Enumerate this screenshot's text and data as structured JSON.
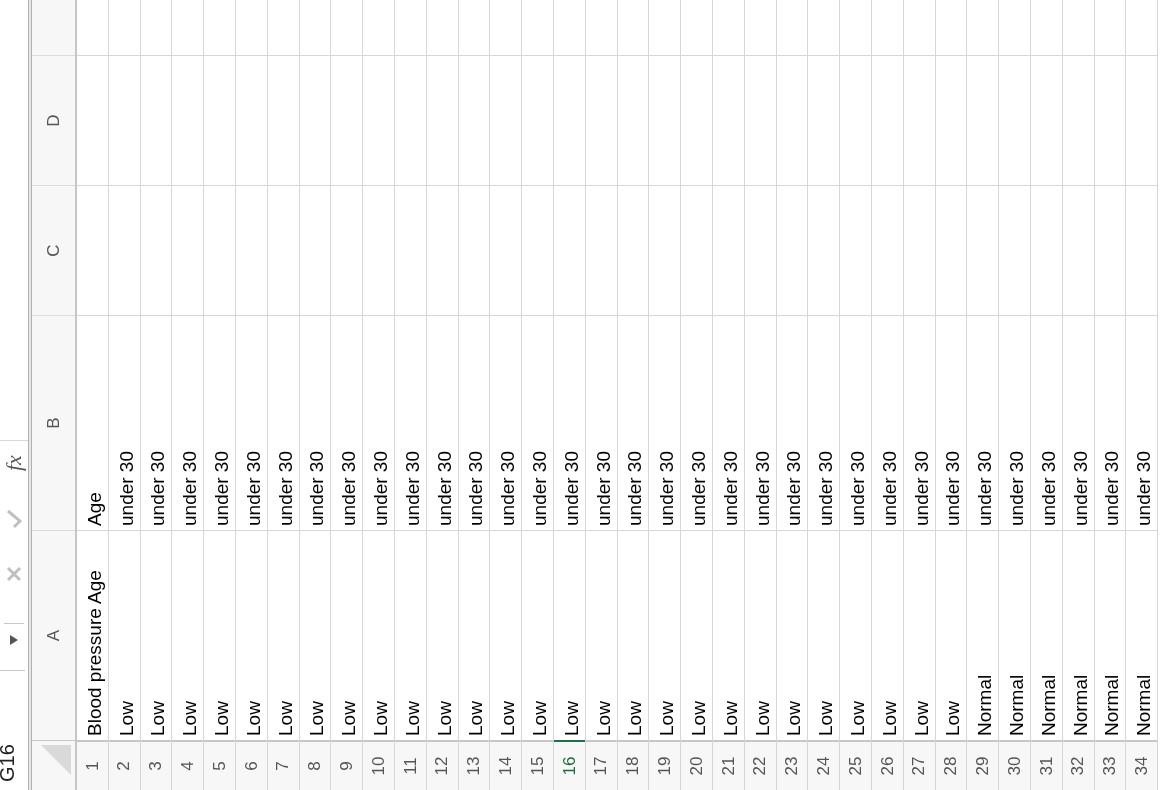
{
  "formula_bar": {
    "name_box": "G16",
    "function_label": "fx"
  },
  "columns": [
    {
      "label": "A",
      "selected": false
    },
    {
      "label": "B",
      "selected": false
    },
    {
      "label": "C",
      "selected": false
    },
    {
      "label": "D",
      "selected": false
    }
  ],
  "rows": [
    {
      "number": "1",
      "selected": false,
      "cells": [
        "Blood pressure Age",
        "Age"
      ]
    },
    {
      "number": "2",
      "selected": false,
      "cells": [
        "Low",
        "under 30"
      ]
    },
    {
      "number": "3",
      "selected": false,
      "cells": [
        "Low",
        "under 30"
      ]
    },
    {
      "number": "4",
      "selected": false,
      "cells": [
        "Low",
        "under 30"
      ]
    },
    {
      "number": "5",
      "selected": false,
      "cells": [
        "Low",
        "under 30"
      ]
    },
    {
      "number": "6",
      "selected": false,
      "cells": [
        "Low",
        "under 30"
      ]
    },
    {
      "number": "7",
      "selected": false,
      "cells": [
        "Low",
        "under 30"
      ]
    },
    {
      "number": "8",
      "selected": false,
      "cells": [
        "Low",
        "under 30"
      ]
    },
    {
      "number": "9",
      "selected": false,
      "cells": [
        "Low",
        "under 30"
      ]
    },
    {
      "number": "10",
      "selected": false,
      "cells": [
        "Low",
        "under 30"
      ]
    },
    {
      "number": "11",
      "selected": false,
      "cells": [
        "Low",
        "under 30"
      ]
    },
    {
      "number": "12",
      "selected": false,
      "cells": [
        "Low",
        "under 30"
      ]
    },
    {
      "number": "13",
      "selected": false,
      "cells": [
        "Low",
        "under 30"
      ]
    },
    {
      "number": "14",
      "selected": false,
      "cells": [
        "Low",
        "under 30"
      ]
    },
    {
      "number": "15",
      "selected": false,
      "cells": [
        "Low",
        "under 30"
      ]
    },
    {
      "number": "16",
      "selected": true,
      "cells": [
        "Low",
        "under 30"
      ]
    },
    {
      "number": "17",
      "selected": false,
      "cells": [
        "Low",
        "under 30"
      ]
    },
    {
      "number": "18",
      "selected": false,
      "cells": [
        "Low",
        "under 30"
      ]
    },
    {
      "number": "19",
      "selected": false,
      "cells": [
        "Low",
        "under 30"
      ]
    },
    {
      "number": "20",
      "selected": false,
      "cells": [
        "Low",
        "under 30"
      ]
    },
    {
      "number": "21",
      "selected": false,
      "cells": [
        "Low",
        "under 30"
      ]
    },
    {
      "number": "22",
      "selected": false,
      "cells": [
        "Low",
        "under 30"
      ]
    },
    {
      "number": "23",
      "selected": false,
      "cells": [
        "Low",
        "under 30"
      ]
    },
    {
      "number": "24",
      "selected": false,
      "cells": [
        "Low",
        "under 30"
      ]
    },
    {
      "number": "25",
      "selected": false,
      "cells": [
        "Low",
        "under 30"
      ]
    },
    {
      "number": "26",
      "selected": false,
      "cells": [
        "Low",
        "under 30"
      ]
    },
    {
      "number": "27",
      "selected": false,
      "cells": [
        "Low",
        "under 30"
      ]
    },
    {
      "number": "28",
      "selected": false,
      "cells": [
        "Low",
        "under 30"
      ]
    },
    {
      "number": "29",
      "selected": false,
      "cells": [
        "Normal",
        "under 30"
      ]
    },
    {
      "number": "30",
      "selected": false,
      "cells": [
        "Normal",
        "under 30"
      ]
    },
    {
      "number": "31",
      "selected": false,
      "cells": [
        "Normal",
        "under 30"
      ]
    },
    {
      "number": "32",
      "selected": false,
      "cells": [
        "Normal",
        "under 30"
      ]
    },
    {
      "number": "33",
      "selected": false,
      "cells": [
        "Normal",
        "under 30"
      ]
    },
    {
      "number": "34",
      "selected": false,
      "cells": [
        "Normal",
        "under 30"
      ]
    }
  ]
}
